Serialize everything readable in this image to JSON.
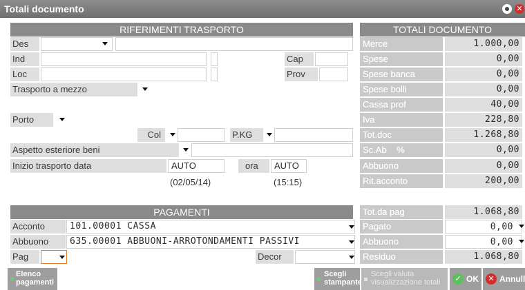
{
  "window": {
    "title": "Totali documento"
  },
  "trasporto": {
    "header": "RIFERIMENTI TRASPORTO",
    "des_label": "Des",
    "ind_label": "Ind",
    "cap_label": "Cap",
    "loc_label": "Loc",
    "prov_label": "Prov",
    "trasporto_label": "Trasporto a mezzo",
    "porto_label": "Porto",
    "col_label": "Col",
    "pkg_label": "P.KG",
    "aspetto_label": "Aspetto esteriore beni",
    "inizio_label": "Inizio trasporto  data",
    "data_value": "AUTO",
    "ora_label": "ora",
    "ora_value": "AUTO",
    "data_hint": "(02/05/14)",
    "ora_hint": "(15:15)"
  },
  "pagamenti": {
    "header": "PAGAMENTI",
    "acconto_label": "Acconto",
    "acconto_value": "101.00001 CASSA",
    "abbuono_label": "Abbuono",
    "abbuono_value": "635.00001 ABBUONI-ARROTONDAMENTI PASSIVI",
    "pag_label": "Pag",
    "decor_label": "Decor"
  },
  "totali": {
    "header": "TOTALI DOCUMENTO",
    "rows": [
      {
        "label": "Merce",
        "value": "1.000,00"
      },
      {
        "label": "Spese",
        "value": "0,00"
      },
      {
        "label": "Spese banca",
        "value": "0,00"
      },
      {
        "label": "Spese bolli",
        "value": "0,00"
      },
      {
        "label": "Cassa prof",
        "value": "40,00"
      },
      {
        "label": "Iva",
        "value": "228,80"
      },
      {
        "label": "Tot.doc",
        "value": "1.268,80"
      },
      {
        "label": "Sc.Ab    %",
        "value": "0,00"
      },
      {
        "label": "Abbuono",
        "value": "0,00"
      },
      {
        "label": "Rit.acconto",
        "value": "200,00"
      }
    ],
    "totdapag_label": "Tot.da pag",
    "totdapag_value": "1.068,80",
    "pagato_label": "Pagato",
    "pagato_value": "0,00",
    "abbuono2_label": "Abbuono",
    "abbuono2_value": "0,00",
    "residuo_label": "Residuo",
    "residuo_value": "1.068,80"
  },
  "buttons": {
    "elenco_line1": "Elenco",
    "elenco_line2": "pagamenti",
    "scegli_line1": "Scegli",
    "scegli_line2": "stampante",
    "valuta_line1": "Scegli valuta",
    "valuta_line2": "visualizzazione totali",
    "ok": "OK",
    "annulla": "Annulla"
  },
  "colors": {
    "header": "#8a8a8a",
    "ok_green": "#5cc15c",
    "close_red": "#d22c2c"
  }
}
